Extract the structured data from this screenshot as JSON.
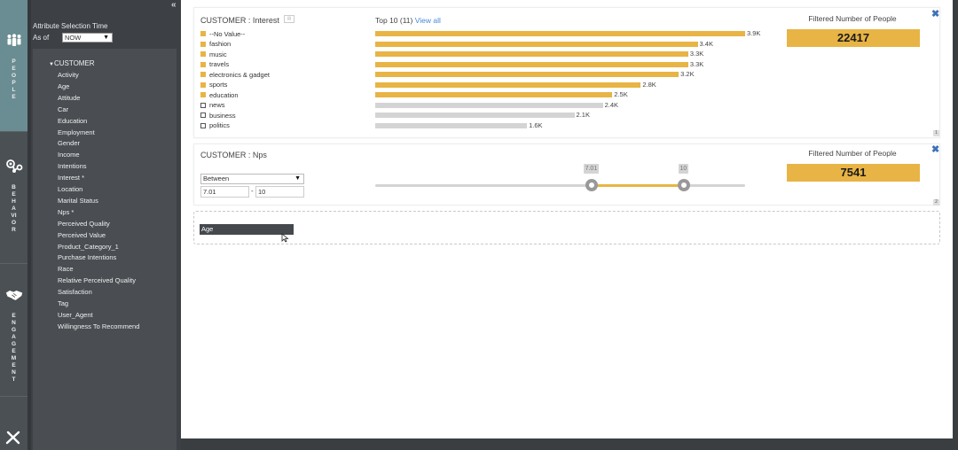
{
  "rail": {
    "sections": [
      {
        "label": "PEOPLE",
        "icon": "people-icon",
        "active": true
      },
      {
        "label": "BEHAVIOR",
        "icon": "behavior-icon",
        "active": false
      },
      {
        "label": "ENGAGEMENT",
        "icon": "handshake-icon",
        "active": false
      }
    ],
    "bottom_icon": "tools-icon"
  },
  "panel": {
    "collapse_glyph": "«",
    "attribute_selection_title": "Attribute Selection Time",
    "as_of_label": "As of",
    "as_of_value": "NOW",
    "tree_root": "CUSTOMER",
    "attributes": [
      "Activity",
      "Age",
      "Attitude",
      "Car",
      "Education",
      "Employment",
      "Gender",
      "Income",
      "Intentions",
      "Interest *",
      "Location",
      "Marital Status",
      "Nps *",
      "Perceived Quality",
      "Perceived Value",
      "Product_Category_1",
      "Purchase Intentions",
      "Race",
      "Relative Perceived Quality",
      "Satisfaction",
      "Tag",
      "User_Agent",
      "Willingness To Recommend"
    ]
  },
  "cards": [
    {
      "title": "CUSTOMER : Interest",
      "top_n_label": "Top 10 (11)",
      "view_all_label": "View all",
      "filtered_label": "Filtered Number of People",
      "filtered_value": "22417",
      "card_number": "1",
      "accent_color": "#e8b445",
      "inactive_color": "#d4d4d4",
      "chart_data": {
        "type": "bar",
        "orientation": "horizontal",
        "categories": [
          "--No Value--",
          "fashion",
          "music",
          "travels",
          "electronics & gadget",
          "sports",
          "education",
          "news",
          "business",
          "politics"
        ],
        "values": [
          3900,
          3400,
          3300,
          3300,
          3200,
          2800,
          2500,
          2400,
          2100,
          1600
        ],
        "value_labels": [
          "3.9K",
          "3.4K",
          "3.3K",
          "3.3K",
          "3.2K",
          "2.8K",
          "2.5K",
          "2.4K",
          "2.1K",
          "1.6K"
        ],
        "selected": [
          true,
          true,
          true,
          true,
          true,
          true,
          true,
          false,
          false,
          false
        ]
      }
    },
    {
      "title": "CUSTOMER : Nps",
      "operator": "Between",
      "min_value": "7.01",
      "max_value": "10",
      "range_separator": "-",
      "filtered_label": "Filtered Number of People",
      "filtered_value": "7541",
      "card_number": "2",
      "slider": {
        "range_min": 0,
        "range_max": 12,
        "low": 7.01,
        "high": 10,
        "low_label": "7.01",
        "high_label": "10"
      }
    }
  ],
  "dropzone": {
    "dragged_item": "Age"
  }
}
